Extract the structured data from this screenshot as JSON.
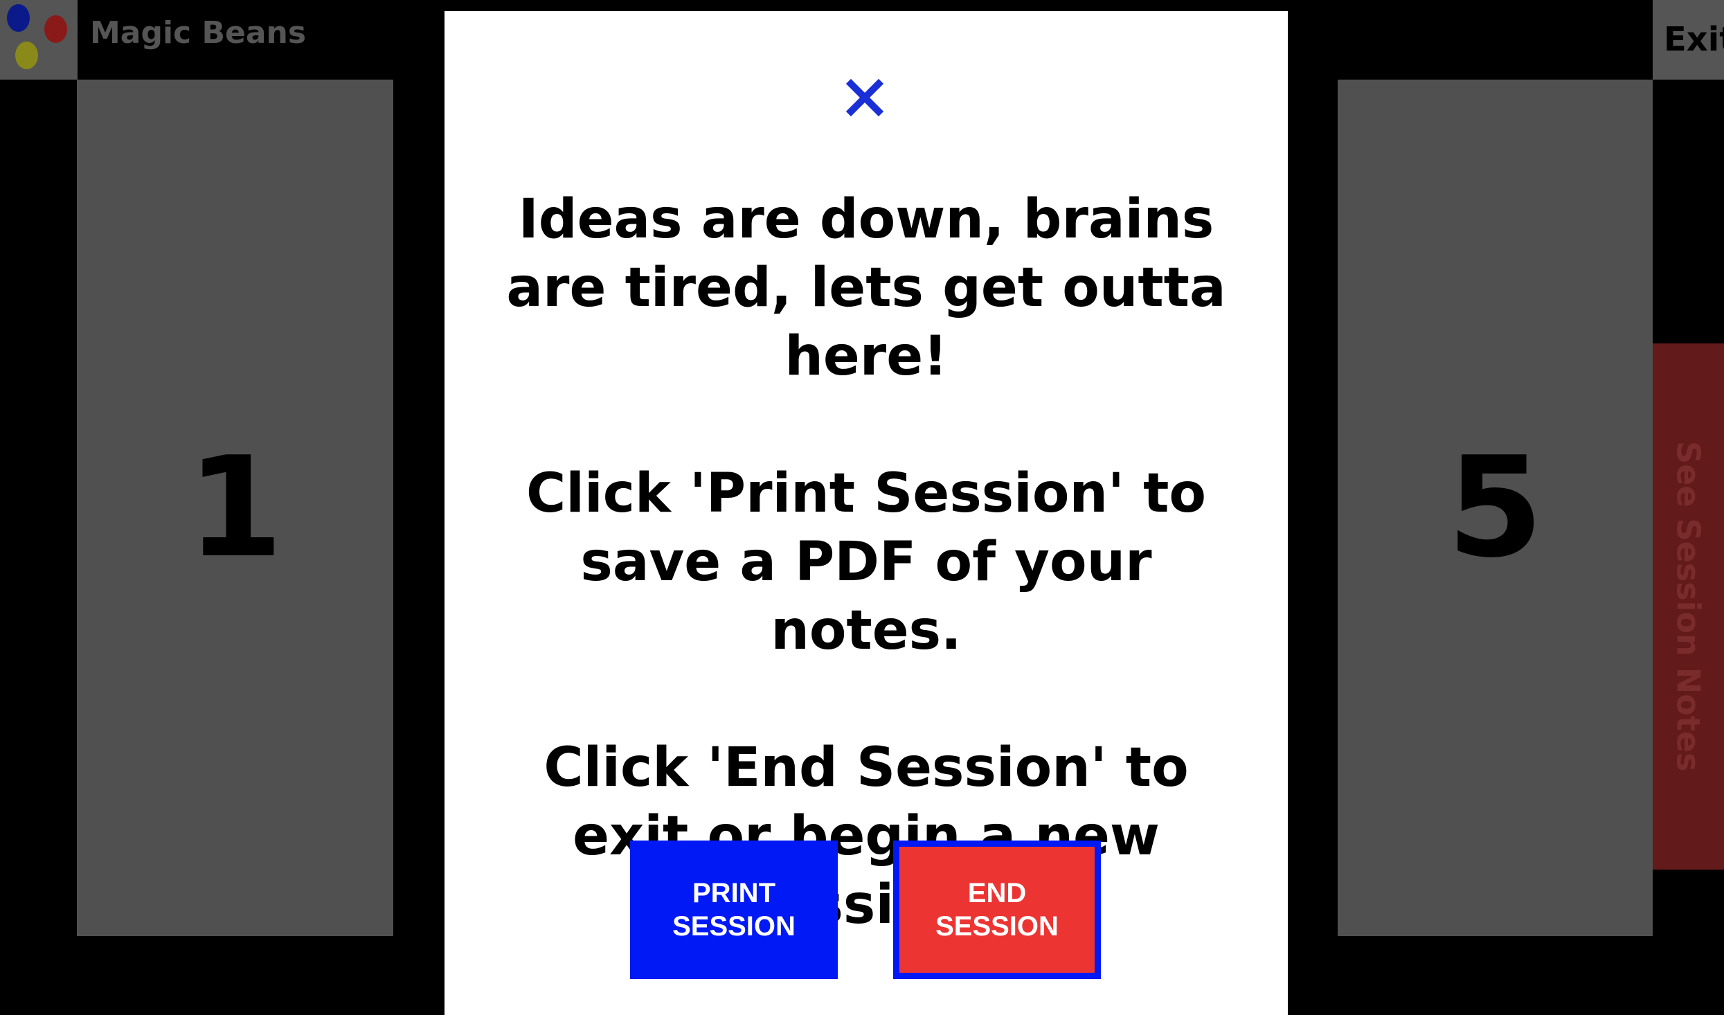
{
  "app": {
    "title": "Magic Beans",
    "logo_colors": [
      "#0a1a8a",
      "#8a1a1a",
      "#8a8a1a"
    ],
    "exit_label": "Exit"
  },
  "cards": {
    "left_number": "1",
    "right_number": "5"
  },
  "side_tab": {
    "label": "See Session Notes"
  },
  "modal": {
    "close_icon": "close-icon",
    "paragraphs": [
      "Ideas are down, brains are tired, lets get outta here!",
      "Click 'Print Session' to save a PDF of your notes.",
      "Click 'End Session' to exit or begin a new session."
    ],
    "print_button": "PRINT\nSESSION",
    "end_button": "END\nSESSION"
  },
  "colors": {
    "accent_blue": "#0019f5",
    "end_red": "#ec3433",
    "card_gray": "#505050",
    "tab_red": "#621a1a"
  }
}
